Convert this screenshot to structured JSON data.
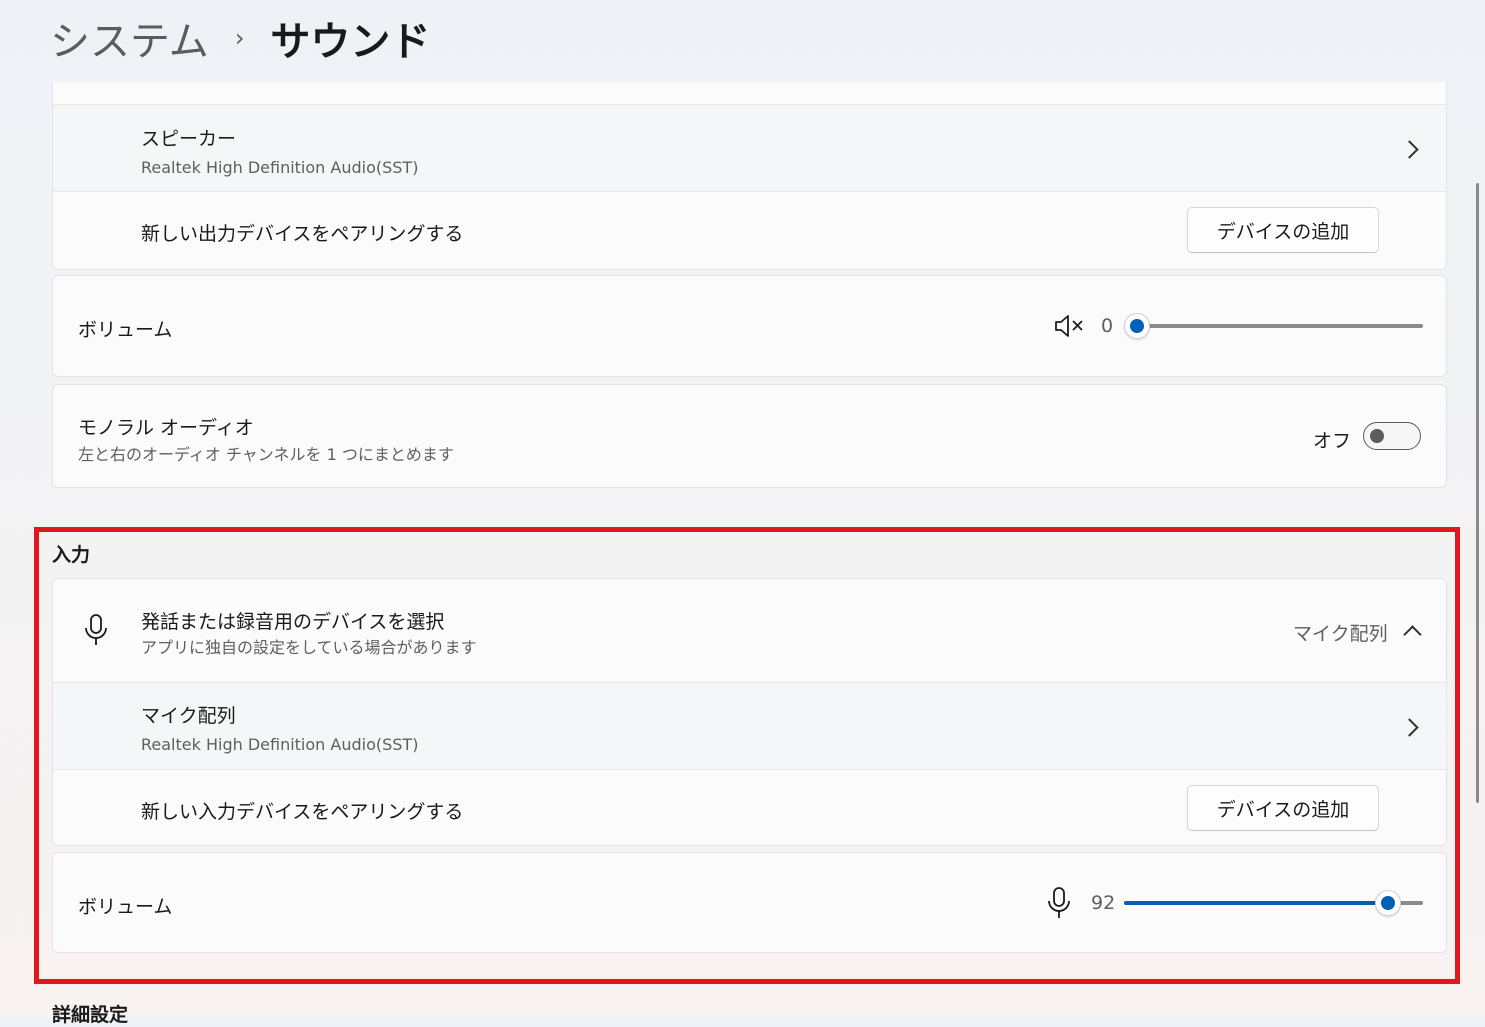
{
  "breadcrumb": {
    "parent": "システム",
    "separator": "›",
    "current": "サウンド"
  },
  "output": {
    "speaker": {
      "title": "スピーカー",
      "subtitle": "Realtek High Definition Audio(SST)"
    },
    "pair": {
      "label": "新しい出力デバイスをペアリングする",
      "button": "デバイスの追加"
    },
    "volume": {
      "label": "ボリューム",
      "value": "0",
      "level": 0,
      "icon": "speaker-muted-icon"
    },
    "mono": {
      "title": "モノラル オーディオ",
      "subtitle": "左と右のオーディオ チャンネルを 1 つにまとめます",
      "state_label": "オフ",
      "enabled": false
    }
  },
  "input": {
    "header": "入力",
    "select": {
      "title": "発話または録音用のデバイスを選択",
      "subtitle": "アプリに独自の設定をしている場合があります",
      "selected": "マイク配列",
      "icon": "microphone-icon"
    },
    "mic": {
      "title": "マイク配列",
      "subtitle": "Realtek High Definition Audio(SST)"
    },
    "pair": {
      "label": "新しい入力デバイスをペアリングする",
      "button": "デバイスの追加"
    },
    "volume": {
      "label": "ボリューム",
      "value": "92",
      "level": 92,
      "icon": "microphone-icon"
    }
  },
  "advanced": {
    "header": "詳細設定"
  },
  "colors": {
    "accent": "#005fb8",
    "highlight": "#e0181c"
  }
}
